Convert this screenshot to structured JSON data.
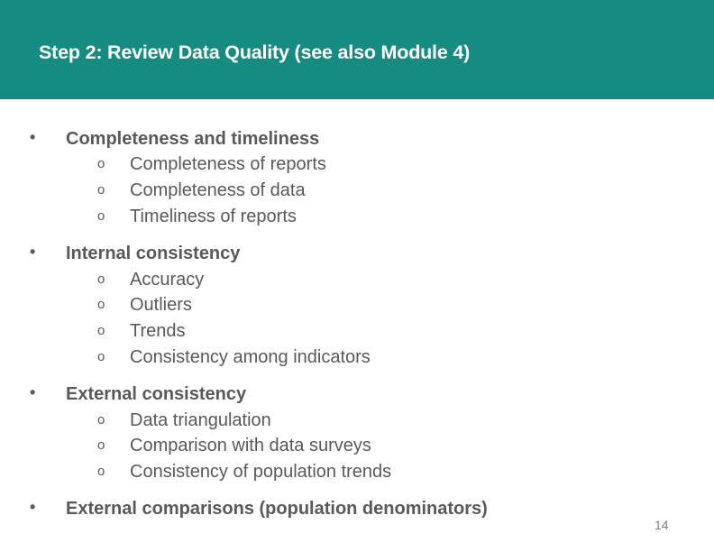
{
  "slide": {
    "title": "Step 2: Review Data Quality (see also Module 4)",
    "header_color": "#168b82",
    "text_color": "#595959",
    "page_number": "14"
  },
  "bullet_glyph": "•",
  "sub_glyph": "o",
  "items": [
    {
      "label": "Completeness and timeliness",
      "subitems": [
        "Completeness of reports",
        "Completeness of data",
        "Timeliness of reports"
      ]
    },
    {
      "label": "Internal consistency",
      "subitems": [
        "Accuracy",
        "Outliers",
        "Trends",
        "Consistency among indicators"
      ]
    },
    {
      "label": "External consistency",
      "subitems": [
        "Data triangulation",
        "Comparison with data surveys",
        "Consistency of population trends"
      ]
    },
    {
      "label": "External comparisons (population denominators)",
      "subitems": []
    }
  ]
}
